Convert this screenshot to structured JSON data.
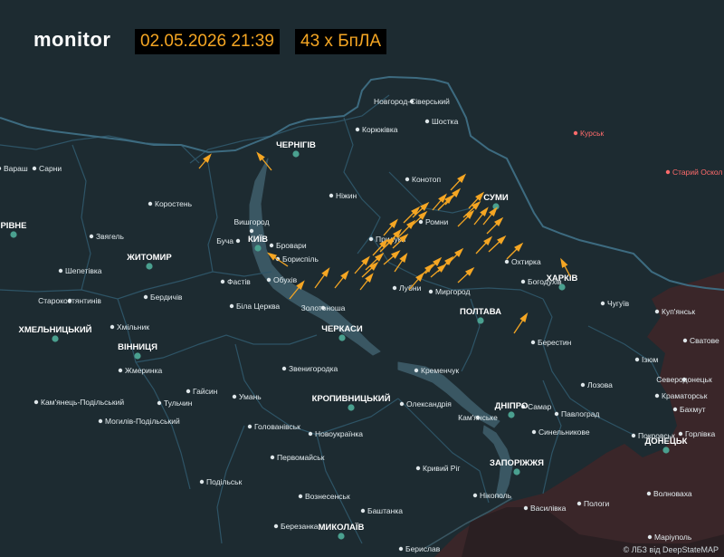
{
  "header": {
    "brand": "monitor",
    "datetime": "02.05.2026 21:39",
    "count_text": "43 х БпЛА"
  },
  "attribution": "© ЛБЗ від DeepStateMAP",
  "colors": {
    "background": "#1d2b31",
    "border": "#3d6b80",
    "water": "#3a5763",
    "occupied": "#3a2629",
    "drone": "#f5a623",
    "city_dot": "#4aa08f",
    "russia_city": "#ff6b6b",
    "label": "#e3ebee"
  },
  "map": {
    "cities": [
      {
        "name": "Новгород-Сіверський",
        "major": false
      },
      {
        "name": "Шостка",
        "major": false
      },
      {
        "name": "Корюківка",
        "major": false
      },
      {
        "name": "ЧЕРНІГІВ",
        "major": true
      },
      {
        "name": "Конотоп",
        "major": false
      },
      {
        "name": "Ніжин",
        "major": false
      },
      {
        "name": "СУМИ",
        "major": true
      },
      {
        "name": "Ромни",
        "major": false
      },
      {
        "name": "Прилуки",
        "major": false
      },
      {
        "name": "Вишгород",
        "major": false
      },
      {
        "name": "Буча",
        "major": false
      },
      {
        "name": "КИЇВ",
        "major": true
      },
      {
        "name": "Бровари",
        "major": false
      },
      {
        "name": "Бориспіль",
        "major": false
      },
      {
        "name": "Фастів",
        "major": false
      },
      {
        "name": "Обухів",
        "major": false
      },
      {
        "name": "Біла Церква",
        "major": false
      },
      {
        "name": "Лубни",
        "major": false
      },
      {
        "name": "Миргород",
        "major": false
      },
      {
        "name": "Охтирка",
        "major": false
      },
      {
        "name": "Богодухів",
        "major": false
      },
      {
        "name": "ХАРКІВ",
        "major": true
      },
      {
        "name": "Чугуїв",
        "major": false
      },
      {
        "name": "ПОЛТАВА",
        "major": true
      },
      {
        "name": "Золотоноша",
        "major": false
      },
      {
        "name": "ЧЕРКАСИ",
        "major": true
      },
      {
        "name": "Звенигородка",
        "major": false
      },
      {
        "name": "Кременчук",
        "major": false
      },
      {
        "name": "Берестин",
        "major": false
      },
      {
        "name": "Ізюм",
        "major": false
      },
      {
        "name": "Лозова",
        "major": false
      },
      {
        "name": "Куп'янськ",
        "major": false
      },
      {
        "name": "Сватове",
        "major": false
      },
      {
        "name": "Северодонецьк",
        "major": false
      },
      {
        "name": "Краматорськ",
        "major": false
      },
      {
        "name": "Бахмут",
        "major": false
      },
      {
        "name": "Горлівка",
        "major": false
      },
      {
        "name": "ДОНЕЦЬК",
        "major": true
      },
      {
        "name": "Покровськ",
        "major": false
      },
      {
        "name": "Павлоград",
        "major": false
      },
      {
        "name": "Самар",
        "major": false
      },
      {
        "name": "ДНІПРО",
        "major": true
      },
      {
        "name": "Кам'янське",
        "major": false
      },
      {
        "name": "Олександрія",
        "major": false
      },
      {
        "name": "КРОПИВНИЦЬКИЙ",
        "major": true
      },
      {
        "name": "Синельникове",
        "major": false
      },
      {
        "name": "Кривий Ріг",
        "major": false
      },
      {
        "name": "ЗАПОРІЖЖЯ",
        "major": true
      },
      {
        "name": "Нікополь",
        "major": false
      },
      {
        "name": "Василівка",
        "major": false
      },
      {
        "name": "Пологи",
        "major": false
      },
      {
        "name": "Волноваха",
        "major": false
      },
      {
        "name": "Маріуполь",
        "major": false
      },
      {
        "name": "Берислав",
        "major": false
      },
      {
        "name": "Баштанка",
        "major": false
      },
      {
        "name": "МИКОЛАЇВ",
        "major": true
      },
      {
        "name": "Березанка",
        "major": false
      },
      {
        "name": "Вознесенськ",
        "major": false
      },
      {
        "name": "Первомайськ",
        "major": false
      },
      {
        "name": "Новоукраїнка",
        "major": false
      },
      {
        "name": "Голованівськ",
        "major": false
      },
      {
        "name": "Гайсин",
        "major": false
      },
      {
        "name": "Умань",
        "major": false
      },
      {
        "name": "Тульчин",
        "major": false
      },
      {
        "name": "Могилів-Подільський",
        "major": false
      },
      {
        "name": "Кам'янець-Подільський",
        "major": false
      },
      {
        "name": "Жмеринка",
        "major": false
      },
      {
        "name": "ВІННИЦЯ",
        "major": true
      },
      {
        "name": "Хмільник",
        "major": false
      },
      {
        "name": "Бердичів",
        "major": false
      },
      {
        "name": "ХМЕЛЬНИЦЬКИЙ",
        "major": true
      },
      {
        "name": "Старокостянтинів",
        "major": false
      },
      {
        "name": "Шепетівка",
        "major": false
      },
      {
        "name": "ЖИТОМИР",
        "major": true
      },
      {
        "name": "Звягель",
        "major": false
      },
      {
        "name": "Коростень",
        "major": false
      },
      {
        "name": "РІВНЕ",
        "major": true
      },
      {
        "name": "Сарни",
        "major": false
      },
      {
        "name": "Вараш",
        "major": false
      },
      {
        "name": "Подільськ",
        "major": false
      },
      {
        "name": "Курськ",
        "major": false,
        "russia": true
      },
      {
        "name": "Старий Оскол",
        "major": false,
        "russia": true
      }
    ],
    "drone_count": 43
  }
}
